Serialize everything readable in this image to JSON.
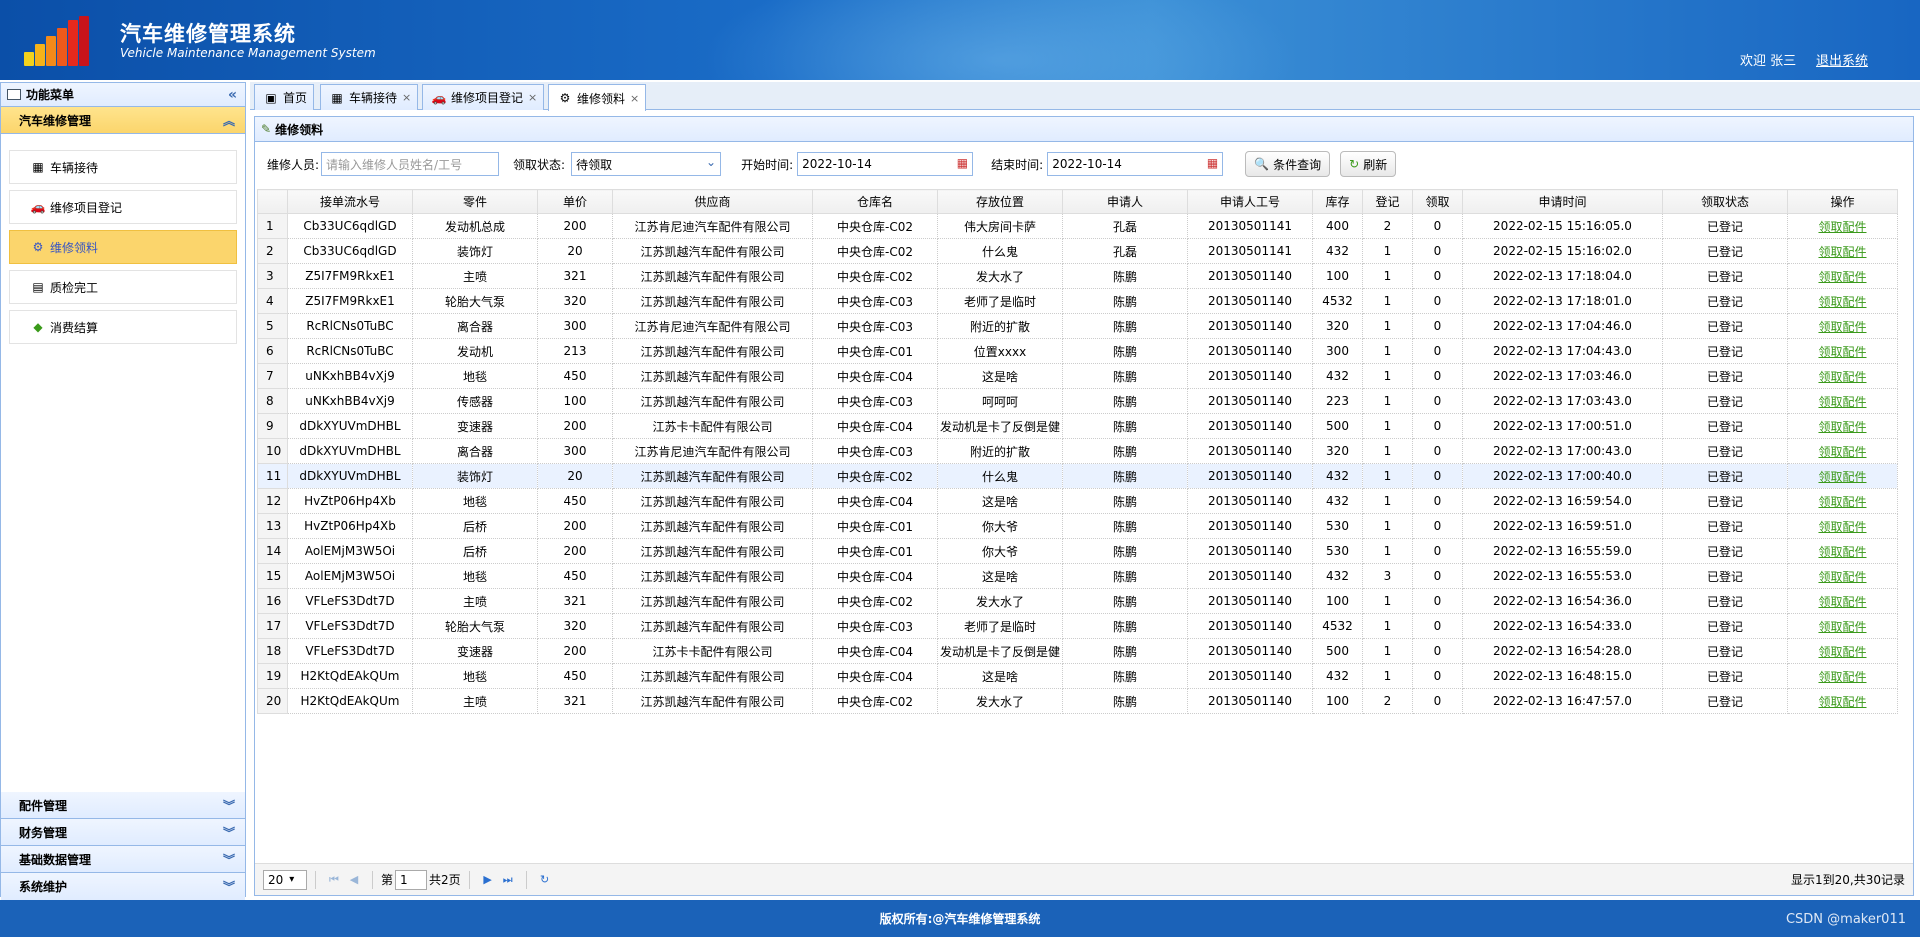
{
  "header": {
    "title": "汽车维修管理系统",
    "subtitle": "Vehicle Maintenance Management System",
    "welcome": "欢迎 张三",
    "logout": "退出系统"
  },
  "sidebar": {
    "title": "功能菜单",
    "sections": [
      {
        "label": "汽车维修管理",
        "expanded": true
      },
      {
        "label": "配件管理"
      },
      {
        "label": "财务管理"
      },
      {
        "label": "基础数据管理"
      },
      {
        "label": "系统维护"
      }
    ],
    "items": [
      {
        "label": "车辆接待",
        "icon": "car-reception-icon"
      },
      {
        "label": "维修项目登记",
        "icon": "car-icon"
      },
      {
        "label": "维修领料",
        "icon": "parts-icon",
        "selected": true
      },
      {
        "label": "质检完工",
        "icon": "check-doc-icon"
      },
      {
        "label": "消费结算",
        "icon": "settle-icon"
      }
    ]
  },
  "tabs": [
    {
      "label": "首页",
      "icon": "home-icon"
    },
    {
      "label": "车辆接待",
      "icon": "car-reception-icon"
    },
    {
      "label": "维修项目登记",
      "icon": "car-icon"
    },
    {
      "label": "维修领料",
      "icon": "parts-icon",
      "active": true
    }
  ],
  "panel": {
    "title": "维修领料"
  },
  "filters": {
    "person_label": "维修人员:",
    "person_placeholder": "请输入维修人员姓名/工号",
    "status_label": "领取状态:",
    "status_value": "待领取",
    "start_label": "开始时间:",
    "start_value": "2022-10-14",
    "end_label": "结束时间:",
    "end_value": "2022-10-14",
    "query_button": "条件查询",
    "refresh_button": "刷新"
  },
  "table": {
    "columns": [
      "接单流水号",
      "零件",
      "单价",
      "供应商",
      "仓库名",
      "存放位置",
      "申请人",
      "申请人工号",
      "库存",
      "登记",
      "领取",
      "申请时间",
      "领取状态",
      "操作"
    ],
    "rows": [
      [
        "1",
        "Cb33UC6qdlGD",
        "发动机总成",
        "200",
        "江苏肯尼迪汽车配件有限公司",
        "中央仓库-C02",
        "伟大房间卡萨",
        "孔磊",
        "20130501141",
        "400",
        "2",
        "0",
        "2022-02-15 15:16:05.0",
        "已登记",
        "领取配件"
      ],
      [
        "2",
        "Cb33UC6qdlGD",
        "装饰灯",
        "20",
        "江苏凯越汽车配件有限公司",
        "中央仓库-C02",
        "什么鬼",
        "孔磊",
        "20130501141",
        "432",
        "1",
        "0",
        "2022-02-15 15:16:02.0",
        "已登记",
        "领取配件"
      ],
      [
        "3",
        "Z5I7FM9RkxE1",
        "主喷",
        "321",
        "江苏凯越汽车配件有限公司",
        "中央仓库-C02",
        "发大水了",
        "陈鹏",
        "20130501140",
        "100",
        "1",
        "0",
        "2022-02-13 17:18:04.0",
        "已登记",
        "领取配件"
      ],
      [
        "4",
        "Z5I7FM9RkxE1",
        "轮胎大气泵",
        "320",
        "江苏凯越汽车配件有限公司",
        "中央仓库-C03",
        "老师了是临时",
        "陈鹏",
        "20130501140",
        "4532",
        "1",
        "0",
        "2022-02-13 17:18:01.0",
        "已登记",
        "领取配件"
      ],
      [
        "5",
        "RcRlCNs0TuBC",
        "离合器",
        "300",
        "江苏肯尼迪汽车配件有限公司",
        "中央仓库-C03",
        "附近的扩散",
        "陈鹏",
        "20130501140",
        "320",
        "1",
        "0",
        "2022-02-13 17:04:46.0",
        "已登记",
        "领取配件"
      ],
      [
        "6",
        "RcRlCNs0TuBC",
        "发动机",
        "213",
        "江苏凯越汽车配件有限公司",
        "中央仓库-C01",
        "位置xxxx",
        "陈鹏",
        "20130501140",
        "300",
        "1",
        "0",
        "2022-02-13 17:04:43.0",
        "已登记",
        "领取配件"
      ],
      [
        "7",
        "uNKxhBB4vXj9",
        "地毯",
        "450",
        "江苏凯越汽车配件有限公司",
        "中央仓库-C04",
        "这是啥",
        "陈鹏",
        "20130501140",
        "432",
        "1",
        "0",
        "2022-02-13 17:03:46.0",
        "已登记",
        "领取配件"
      ],
      [
        "8",
        "uNKxhBB4vXj9",
        "传感器",
        "100",
        "江苏凯越汽车配件有限公司",
        "中央仓库-C03",
        "呵呵呵",
        "陈鹏",
        "20130501140",
        "223",
        "1",
        "0",
        "2022-02-13 17:03:43.0",
        "已登记",
        "领取配件"
      ],
      [
        "9",
        "dDkXYUVmDHBL",
        "变速器",
        "200",
        "江苏卡卡配件有限公司",
        "中央仓库-C04",
        "发动机是卡了反倒是健",
        "陈鹏",
        "20130501140",
        "500",
        "1",
        "0",
        "2022-02-13 17:00:51.0",
        "已登记",
        "领取配件"
      ],
      [
        "10",
        "dDkXYUVmDHBL",
        "离合器",
        "300",
        "江苏肯尼迪汽车配件有限公司",
        "中央仓库-C03",
        "附近的扩散",
        "陈鹏",
        "20130501140",
        "320",
        "1",
        "0",
        "2022-02-13 17:00:43.0",
        "已登记",
        "领取配件"
      ],
      [
        "11",
        "dDkXYUVmDHBL",
        "装饰灯",
        "20",
        "江苏凯越汽车配件有限公司",
        "中央仓库-C02",
        "什么鬼",
        "陈鹏",
        "20130501140",
        "432",
        "1",
        "0",
        "2022-02-13 17:00:40.0",
        "已登记",
        "领取配件"
      ],
      [
        "12",
        "HvZtP06Hp4Xb",
        "地毯",
        "450",
        "江苏凯越汽车配件有限公司",
        "中央仓库-C04",
        "这是啥",
        "陈鹏",
        "20130501140",
        "432",
        "1",
        "0",
        "2022-02-13 16:59:54.0",
        "已登记",
        "领取配件"
      ],
      [
        "13",
        "HvZtP06Hp4Xb",
        "后桥",
        "200",
        "江苏凯越汽车配件有限公司",
        "中央仓库-C01",
        "你大爷",
        "陈鹏",
        "20130501140",
        "530",
        "1",
        "0",
        "2022-02-13 16:59:51.0",
        "已登记",
        "领取配件"
      ],
      [
        "14",
        "AolEMjM3W5Oi",
        "后桥",
        "200",
        "江苏凯越汽车配件有限公司",
        "中央仓库-C01",
        "你大爷",
        "陈鹏",
        "20130501140",
        "530",
        "1",
        "0",
        "2022-02-13 16:55:59.0",
        "已登记",
        "领取配件"
      ],
      [
        "15",
        "AolEMjM3W5Oi",
        "地毯",
        "450",
        "江苏凯越汽车配件有限公司",
        "中央仓库-C04",
        "这是啥",
        "陈鹏",
        "20130501140",
        "432",
        "3",
        "0",
        "2022-02-13 16:55:53.0",
        "已登记",
        "领取配件"
      ],
      [
        "16",
        "VFLeFS3Ddt7D",
        "主喷",
        "321",
        "江苏凯越汽车配件有限公司",
        "中央仓库-C02",
        "发大水了",
        "陈鹏",
        "20130501140",
        "100",
        "1",
        "0",
        "2022-02-13 16:54:36.0",
        "已登记",
        "领取配件"
      ],
      [
        "17",
        "VFLeFS3Ddt7D",
        "轮胎大气泵",
        "320",
        "江苏凯越汽车配件有限公司",
        "中央仓库-C03",
        "老师了是临时",
        "陈鹏",
        "20130501140",
        "4532",
        "1",
        "0",
        "2022-02-13 16:54:33.0",
        "已登记",
        "领取配件"
      ],
      [
        "18",
        "VFLeFS3Ddt7D",
        "变速器",
        "200",
        "江苏卡卡配件有限公司",
        "中央仓库-C04",
        "发动机是卡了反倒是健",
        "陈鹏",
        "20130501140",
        "500",
        "1",
        "0",
        "2022-02-13 16:54:28.0",
        "已登记",
        "领取配件"
      ],
      [
        "19",
        "H2KtQdEAkQUm",
        "地毯",
        "450",
        "江苏凯越汽车配件有限公司",
        "中央仓库-C04",
        "这是啥",
        "陈鹏",
        "20130501140",
        "432",
        "1",
        "0",
        "2022-02-13 16:48:15.0",
        "已登记",
        "领取配件"
      ],
      [
        "20",
        "H2KtQdEAkQUm",
        "主喷",
        "321",
        "江苏凯越汽车配件有限公司",
        "中央仓库-C02",
        "发大水了",
        "陈鹏",
        "20130501140",
        "100",
        "2",
        "0",
        "2022-02-13 16:47:57.0",
        "已登记",
        "领取配件"
      ]
    ],
    "highlighted_row": 11
  },
  "pager": {
    "page_size": "20",
    "page_prefix": "第",
    "current_page": "1",
    "total_pages": "共2页",
    "summary": "显示1到20,共30记录"
  },
  "footer": {
    "copyright": "版权所有:@汽车维修管理系统"
  },
  "watermark": "CSDN @maker011",
  "colors": {
    "header": "#1a6cc7",
    "menu_selected": "#fbd56c",
    "link": "#3a9a1a",
    "border": "#95b8e7"
  }
}
